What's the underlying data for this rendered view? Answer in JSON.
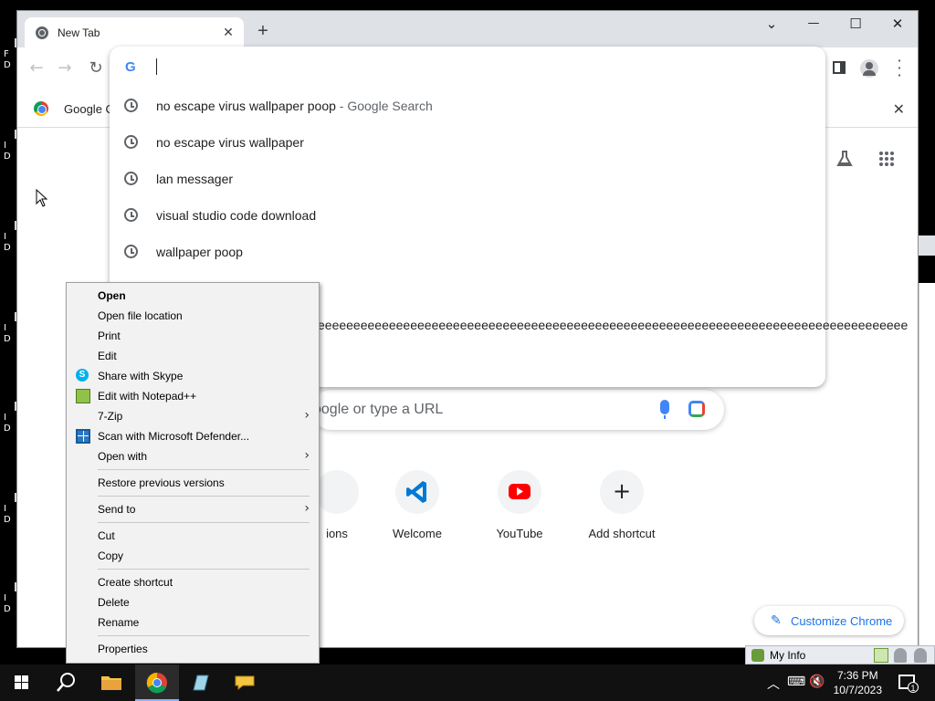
{
  "desktop": {
    "left_fragments": [
      {
        "lines": [
          "F",
          "D"
        ]
      },
      {
        "lines": [
          "I",
          "D"
        ]
      },
      {
        "lines": [
          "I",
          "D"
        ]
      },
      {
        "lines": [
          "I",
          "D"
        ]
      },
      {
        "lines": [
          "I",
          "D"
        ]
      },
      {
        "lines": [
          "I",
          "D"
        ]
      },
      {
        "lines": [
          "I",
          "D"
        ]
      }
    ]
  },
  "browser": {
    "tab_title": "New Tab",
    "tab_close": "✕",
    "new_tab": "+",
    "window_controls": {
      "list": "⌄",
      "minimize": "—",
      "maximize": "☐",
      "close": "✕"
    },
    "nav": {
      "back": "←",
      "forward": "→",
      "reload": "↻"
    },
    "bookmark_bar": {
      "item_label": "Google C",
      "close": "✕"
    },
    "omnibox": {
      "g_logo": "G",
      "suggestions": [
        {
          "text": "no escape virus wallpaper poop",
          "suffix": " - Google Search"
        },
        {
          "text": "no escape virus wallpaper",
          "suffix": ""
        },
        {
          "text": "lan messager",
          "suffix": ""
        },
        {
          "text": "visual studio code download",
          "suffix": ""
        },
        {
          "text": "wallpaper poop",
          "suffix": ""
        }
      ],
      "overflow_text": "eeeeeeeeeeeeeeeeeeeeeeeeeeeeeeeeeeeeeeeeeeeeeeeeeeeeeeeeeeeeeeeeeeeeeeeeeeeeeeeeeee"
    },
    "ntp": {
      "search_placeholder": "oogle or type a URL",
      "shortcuts": [
        {
          "label": "ions",
          "icon": "extensions-icon"
        },
        {
          "label": "Welcome",
          "icon": "vscode-icon"
        },
        {
          "label": "YouTube",
          "icon": "youtube-icon"
        },
        {
          "label": "Add shortcut",
          "icon": "plus-icon"
        }
      ],
      "customize_label": "Customize Chrome"
    }
  },
  "context_menu": {
    "items": [
      {
        "label": "Open",
        "bold": true
      },
      {
        "label": "Open file location"
      },
      {
        "label": "Print"
      },
      {
        "label": "Edit"
      },
      {
        "label": "Share with Skype"
      },
      {
        "label": "Edit with Notepad++"
      },
      {
        "label": "7-Zip"
      },
      {
        "label": "Scan with Microsoft Defender..."
      },
      {
        "label": "Open with"
      },
      {
        "label": "Restore previous versions"
      },
      {
        "label": "Send to"
      },
      {
        "label": "Cut"
      },
      {
        "label": "Copy"
      },
      {
        "label": "Create shortcut"
      },
      {
        "label": "Delete"
      },
      {
        "label": "Rename"
      },
      {
        "label": "Properties"
      }
    ],
    "submenu_arrow": "›"
  },
  "myinfo": {
    "label": "My Info"
  },
  "taskbar": {
    "time": "7:36 PM",
    "date": "10/7/2023",
    "notification_count": "1"
  },
  "colors": {
    "taskbar": "#111111",
    "tabbar": "#dee1e6",
    "accent": "#1a73e8",
    "youtube": "#ff0000",
    "vscode": "#0078d4"
  }
}
